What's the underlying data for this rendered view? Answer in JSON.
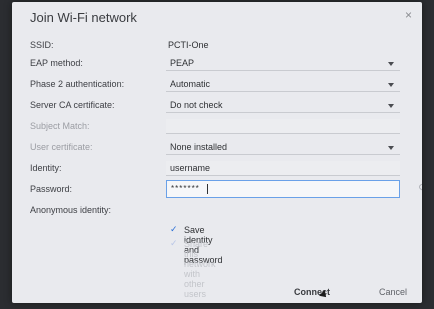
{
  "dialog": {
    "title": "Join Wi-Fi network",
    "close_symbol": "×"
  },
  "fields": {
    "ssid": {
      "label": "SSID:",
      "value": "PCTI-One"
    },
    "eap_method": {
      "label": "EAP method:",
      "value": "PEAP"
    },
    "phase2": {
      "label": "Phase 2 authentication:",
      "value": "Automatic"
    },
    "server_ca": {
      "label": "Server CA certificate:",
      "value": "Do not check"
    },
    "subject_match": {
      "label": "Subject Match:",
      "value": ""
    },
    "user_cert": {
      "label": "User certificate:",
      "value": "None installed"
    },
    "identity": {
      "label": "Identity:",
      "value": "username"
    },
    "password": {
      "label": "Password:",
      "value": "*******"
    },
    "anonymous_identity": {
      "label": "Anonymous identity:",
      "value": ""
    }
  },
  "checks": {
    "save_identity": {
      "label": "Save identity and password",
      "checked": true
    },
    "share_network": {
      "label": "Share this network with other users",
      "checked": true,
      "disabled": true
    }
  },
  "buttons": {
    "connect": "Connect",
    "cancel": "Cancel"
  },
  "colors": {
    "dialog_bg": "#e9eaee",
    "accent": "#2a6fd6",
    "field_focus": "#6aa1e8"
  }
}
